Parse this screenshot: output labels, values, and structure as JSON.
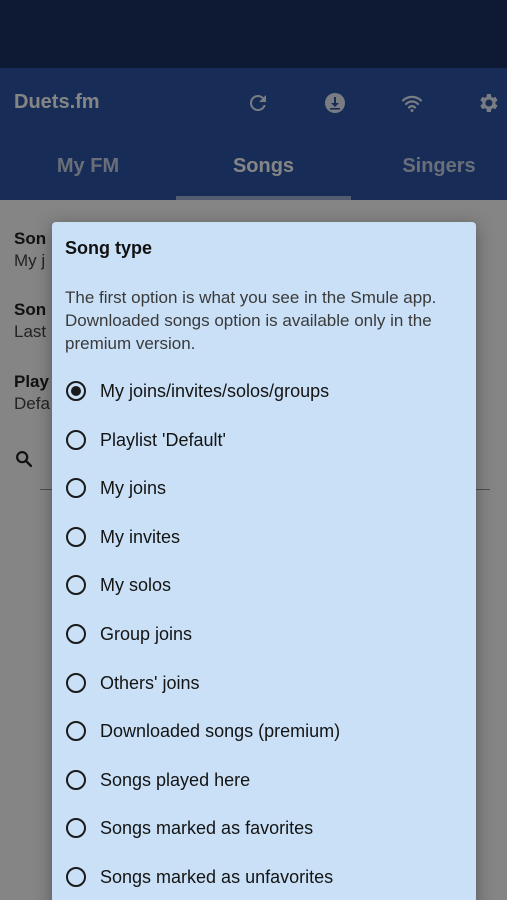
{
  "app": {
    "title": "Duets.fm",
    "icons": [
      "refresh-icon",
      "download-icon",
      "wifi-icon",
      "gear-icon"
    ]
  },
  "tabs": [
    {
      "label": "My FM",
      "selected": false
    },
    {
      "label": "Songs",
      "selected": true
    },
    {
      "label": "Singers",
      "selected": false
    }
  ],
  "background_settings": [
    {
      "title": "Son",
      "value": "My j"
    },
    {
      "title": "Son",
      "value": "Last"
    },
    {
      "title": "Play",
      "value": "Defa"
    }
  ],
  "dialog": {
    "title": "Song type",
    "description": "The first option is what you see in the Smule app. Downloaded songs option is available only in the premium version.",
    "selected_index": 0,
    "options": [
      "My joins/invites/solos/groups",
      "Playlist 'Default'",
      "My joins",
      "My invites",
      "My solos",
      "Group joins",
      "Others' joins",
      "Downloaded songs (premium)",
      "Songs played here",
      "Songs marked as favorites",
      "Songs marked as unfavorites"
    ]
  },
  "colors": {
    "status_bar": "#1b3263",
    "app_bar": "#2c56a8",
    "dialog_bg": "#c9e0f7"
  }
}
